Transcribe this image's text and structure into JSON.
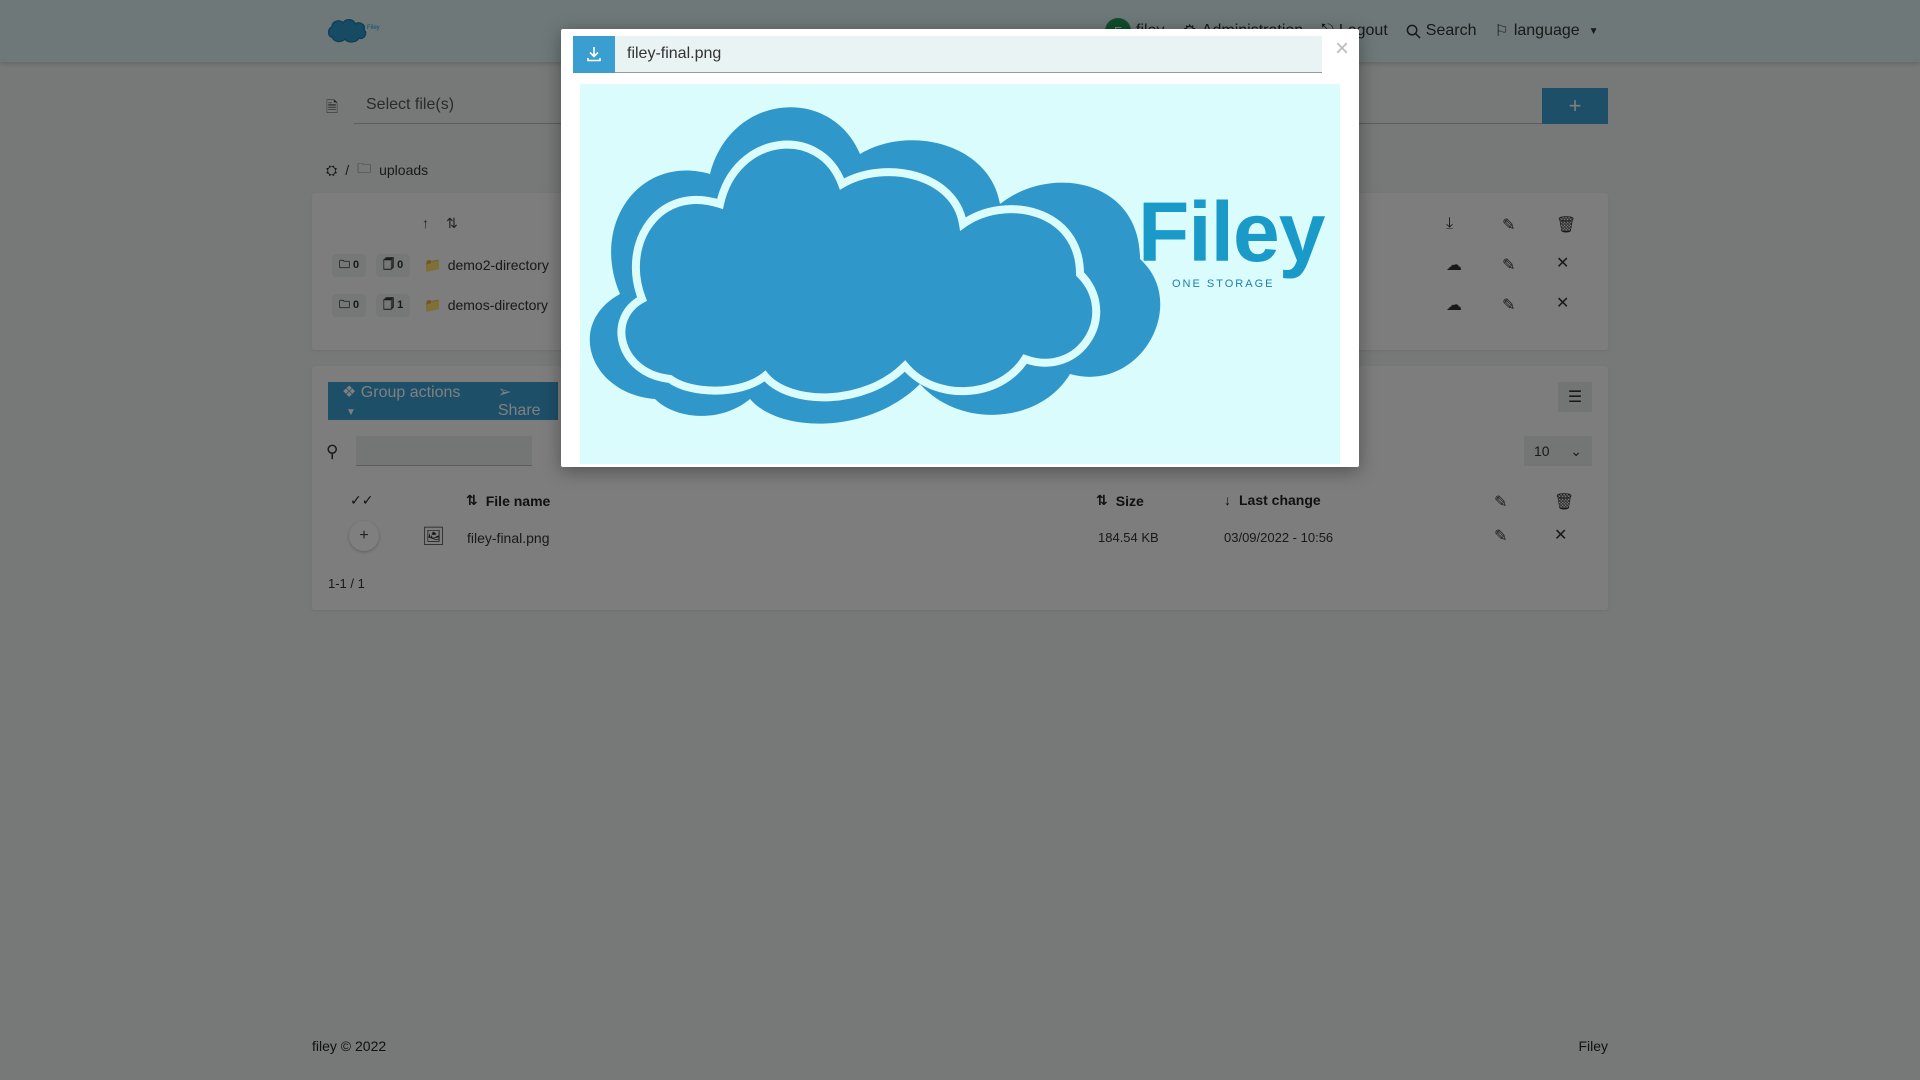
{
  "navbar": {
    "user_initial": "F",
    "user_name": "filey",
    "administration": "Administration",
    "logout": "Logout",
    "search": "Search",
    "language": "language"
  },
  "upload": {
    "placeholder": "Select file(s)",
    "add_label": "+"
  },
  "breadcrumb": {
    "separator": "/",
    "folder": "uploads"
  },
  "directories": [
    {
      "dirs": "0",
      "files": "0",
      "name": "demo2-directory"
    },
    {
      "dirs": "0",
      "files": "1",
      "name": "demos-directory"
    }
  ],
  "files_panel": {
    "group_actions": "Group actions",
    "share": "Share",
    "per_page": "10",
    "columns": {
      "name": "File name",
      "size": "Size",
      "last_change": "Last change"
    },
    "rows": [
      {
        "name": "filey-final.png",
        "size": "184.54 KB",
        "last_change": "03/09/2022 - 10:56"
      }
    ],
    "paging": "1-1 / 1"
  },
  "modal": {
    "title": "filey-final.png",
    "close": "×",
    "preview_brand": "Filey",
    "preview_tagline": "ONE STORAGE"
  },
  "footer": {
    "left": "filey © 2022",
    "right": "Filey"
  },
  "colors": {
    "accent": "#3a9ed1",
    "brand": "#1a9ac9",
    "preview_bg": "#dbfcfd"
  }
}
